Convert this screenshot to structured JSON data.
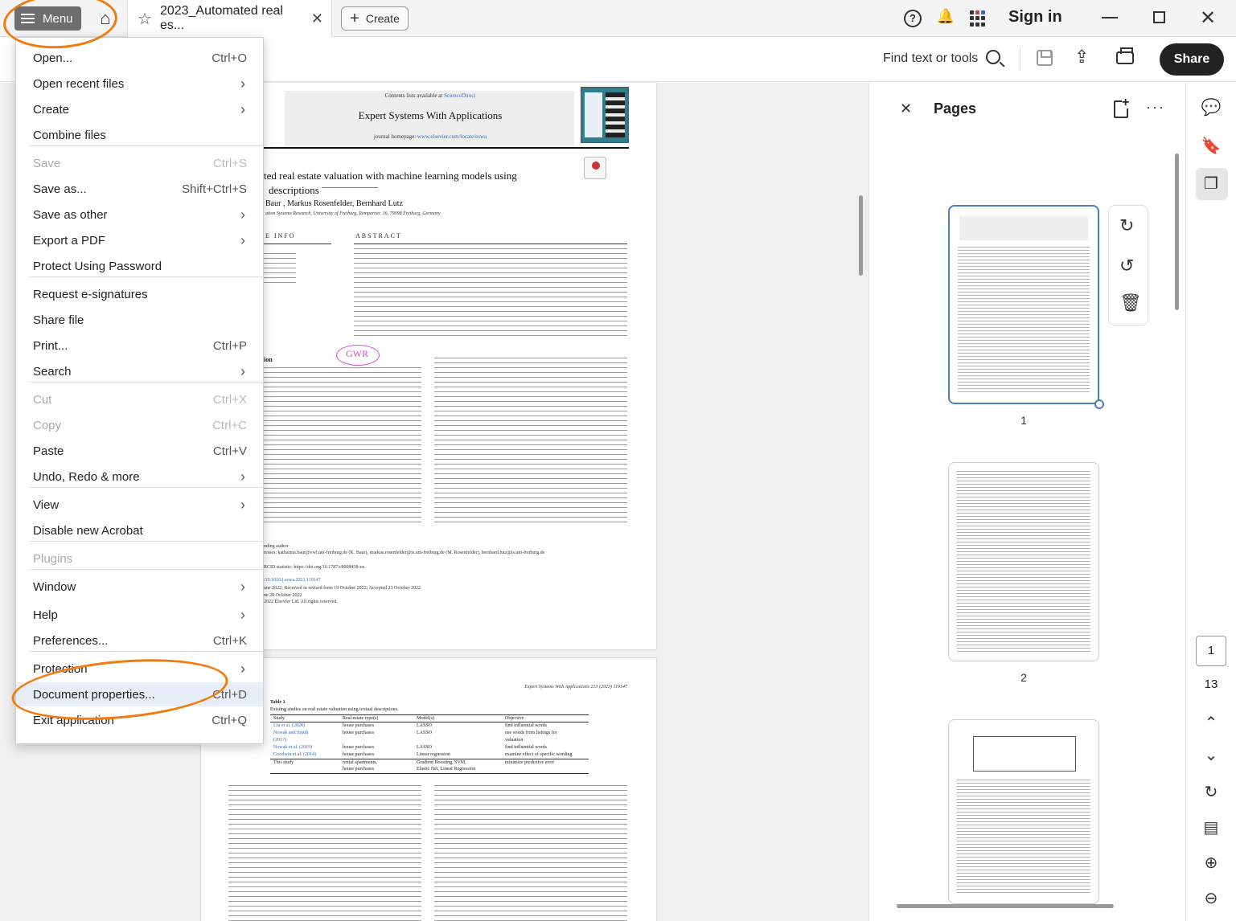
{
  "topbar": {
    "menu_label": "Menu",
    "tab_title": "2023_Automated real es...",
    "create_label": "Create",
    "help_label": "?",
    "signin_label": "Sign in"
  },
  "toolbar": {
    "find_label": "Find text or tools",
    "share_label": "Share"
  },
  "menu": {
    "items": [
      {
        "label": "Open...",
        "shortcut": "Ctrl+O",
        "disabled": false,
        "submenu": false
      },
      {
        "label": "Open recent files",
        "shortcut": "",
        "disabled": false,
        "submenu": true
      },
      {
        "label": "Create",
        "shortcut": "",
        "disabled": false,
        "submenu": true
      },
      {
        "label": "Combine files",
        "shortcut": "",
        "disabled": false,
        "submenu": false
      },
      {
        "label": "Save",
        "shortcut": "Ctrl+S",
        "disabled": true,
        "submenu": false
      },
      {
        "label": "Save as...",
        "shortcut": "Shift+Ctrl+S",
        "disabled": false,
        "submenu": false
      },
      {
        "label": "Save as other",
        "shortcut": "",
        "disabled": false,
        "submenu": true
      },
      {
        "label": "Export a PDF",
        "shortcut": "",
        "disabled": false,
        "submenu": true
      },
      {
        "label": "Protect Using Password",
        "shortcut": "",
        "disabled": false,
        "submenu": false
      },
      {
        "label": "Request e-signatures",
        "shortcut": "",
        "disabled": false,
        "submenu": false
      },
      {
        "label": "Share file",
        "shortcut": "",
        "disabled": false,
        "submenu": false
      },
      {
        "label": "Print...",
        "shortcut": "Ctrl+P",
        "disabled": false,
        "submenu": false
      },
      {
        "label": "Search",
        "shortcut": "",
        "disabled": false,
        "submenu": true
      },
      {
        "label": "Cut",
        "shortcut": "Ctrl+X",
        "disabled": true,
        "submenu": false
      },
      {
        "label": "Copy",
        "shortcut": "Ctrl+C",
        "disabled": true,
        "submenu": false
      },
      {
        "label": "Paste",
        "shortcut": "Ctrl+V",
        "disabled": false,
        "submenu": false
      },
      {
        "label": "Undo, Redo & more",
        "shortcut": "",
        "disabled": false,
        "submenu": true
      },
      {
        "label": "View",
        "shortcut": "",
        "disabled": false,
        "submenu": true
      },
      {
        "label": "Disable new Acrobat",
        "shortcut": "",
        "disabled": false,
        "submenu": false
      },
      {
        "label": "Plugins",
        "shortcut": "",
        "disabled": true,
        "submenu": false
      },
      {
        "label": "Window",
        "shortcut": "",
        "disabled": false,
        "submenu": true
      },
      {
        "label": "Help",
        "shortcut": "",
        "disabled": false,
        "submenu": true
      },
      {
        "label": "Preferences...",
        "shortcut": "Ctrl+K",
        "disabled": false,
        "submenu": false
      },
      {
        "label": "Protection",
        "shortcut": "",
        "disabled": false,
        "submenu": true
      },
      {
        "label": "Document properties...",
        "shortcut": "Ctrl+D",
        "disabled": false,
        "submenu": false,
        "highlighted": true
      },
      {
        "label": "Exit application",
        "shortcut": "Ctrl+Q",
        "disabled": false,
        "submenu": false
      }
    ]
  },
  "pdf": {
    "page1": {
      "contents_prefix": "Contents lists available at",
      "sciencedirect": "ScienceDirect",
      "journal": "Expert Systems With Applications",
      "homepage_prefix": "journal homepage:",
      "homepage_url": "www.elsevier.com/locate/eswa",
      "title_line1": "ted real estate valuation with machine learning models using",
      "title_line2": "descriptions",
      "authors": "Baur , Markus Rosenfelder, Bernhard Lutz",
      "affiliation": "ation Systems Research, University of Freiburg, Rempartstr. 16, 79098 Freiburg, Germany",
      "info_header": "E INFO",
      "abstract_header": "ABSTRACT",
      "annotation": "GWR",
      "section_fragment": "ion",
      "fn_corresponding": "nding author.",
      "fn_email": "resses: katharina.baur@vwl.uni-freiburg.de (K. Baur), markus.rosenfelder@is.uni-freiburg.de (M. Rosenfelder), bernhard.lutz@is.uni-freiburg.de",
      "fn_orcid": "RCID statistic: https://doi.org/10.1787/c8008438-en.",
      "fn_doi": "/10.1016/j.eswa.2022.119147",
      "fn_received": "une 2022; Received in revised form 19 October 2022; Accepted 23 October 2022",
      "fn_online": "ne 28 October 2022",
      "fn_copyright": "2022 Elsevier Ltd. All rights reserved."
    },
    "page2": {
      "running_head": "Expert Systems With Applications 213 (2023) 119147",
      "table_label": "Table 1",
      "table_caption": "Existing studies on real estate valuation using textual descriptions.",
      "table_headers": [
        "Study",
        "Real estate type(s)",
        "Model(s)",
        "Objective"
      ],
      "table_rows": [
        [
          "Liu et al. (2020)",
          "house purchases",
          "LASSO",
          "find influential words"
        ],
        [
          "Nowak and Smith",
          "house purchases",
          "LASSO",
          "use words from listings for"
        ],
        [
          "(2017)",
          "",
          "",
          "valuation"
        ],
        [
          "Nowak et al. (2019)",
          "house purchases",
          "LASSO",
          "find influential words"
        ],
        [
          "Goodwin et al. (2014)",
          "house purchases",
          "Linear regression",
          "examine effect of specific wording"
        ],
        [
          "This study",
          "rental apartments,",
          "Gradient Boosting, SVM,",
          "minimize predictive error"
        ],
        [
          "",
          "house purchases",
          "Elastic Net, Linear Regression",
          ""
        ]
      ]
    }
  },
  "pages_panel": {
    "title": "Pages",
    "thumb_labels": [
      "1",
      "2"
    ]
  },
  "pager": {
    "current": "1",
    "total": "13"
  },
  "colors": {
    "menu_button": "#6e6e6e",
    "annotation_orange": "#f07c10",
    "pdf_markup": "#d44cd4",
    "selection_blue": "#4a7fbf"
  }
}
